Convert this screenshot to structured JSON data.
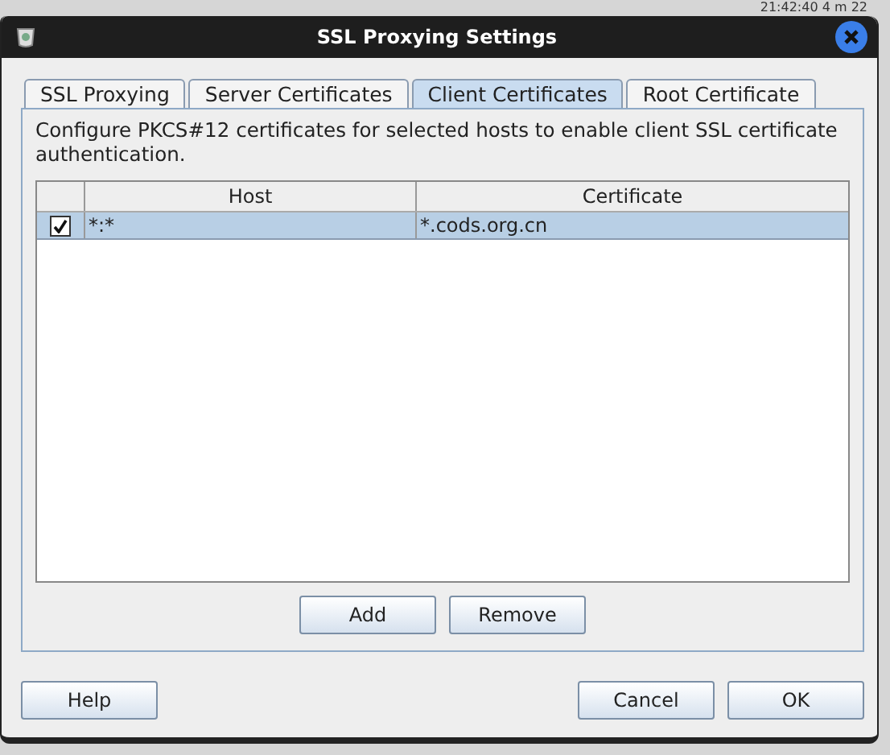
{
  "background_text": "21:42:40  4 m 22",
  "window": {
    "title": "SSL Proxying Settings"
  },
  "tabs": [
    {
      "label": "SSL Proxying",
      "selected": false
    },
    {
      "label": "Server Certificates",
      "selected": false
    },
    {
      "label": "Client Certificates",
      "selected": true
    },
    {
      "label": "Root Certificate",
      "selected": false
    }
  ],
  "description": "Configure PKCS#12 certificates for selected hosts to enable client SSL certificate authentication.",
  "table": {
    "columns": [
      "Host",
      "Certificate"
    ],
    "rows": [
      {
        "checked": true,
        "selected": true,
        "host": "*:*",
        "certificate": "*.cods.org.cn"
      }
    ]
  },
  "panel_buttons": [
    "Add",
    "Remove"
  ],
  "help_button": "Help",
  "dialog_buttons": [
    "Cancel",
    "OK"
  ]
}
